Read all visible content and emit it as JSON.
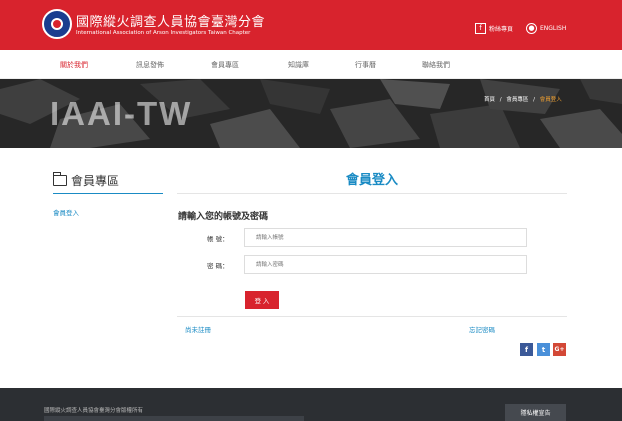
{
  "header": {
    "title": "國際縱火調查人員協會臺灣分會",
    "subtitle": "International Association of Arson Investigators Taiwan Chapter",
    "facebook_label": "粉絲專頁",
    "english_label": "ENGLISH",
    "brand_color": "#d8232d"
  },
  "nav": {
    "items": [
      {
        "label": "關於我們",
        "active": true
      },
      {
        "label": "訊息發佈",
        "active": false
      },
      {
        "label": "會員專區",
        "active": false
      },
      {
        "label": "知識庫",
        "active": false
      },
      {
        "label": "行事曆",
        "active": false
      },
      {
        "label": "聯絡我們",
        "active": false
      }
    ]
  },
  "banner": {
    "title": "IAAI-TW",
    "breadcrumb": [
      "首頁",
      "會員專區",
      "會員登入"
    ],
    "separator": "/"
  },
  "sidebar": {
    "title": "會員專區",
    "links": [
      "會員登入"
    ]
  },
  "login": {
    "heading": "會員登入",
    "prompt": "請輸入您的帳號及密碼",
    "account_label": "帳 號：",
    "account_placeholder": "請輸入帳號",
    "account_value": "",
    "password_label": "密 碼：",
    "password_placeholder": "請輸入密碼",
    "password_value": "",
    "submit_label": "登 入",
    "register_link": "尚未註冊",
    "forgot_link": "忘記密碼"
  },
  "share": {
    "icons": [
      "facebook-icon",
      "twitter-icon",
      "google-plus-icon"
    ],
    "facebook_glyph": "f",
    "twitter_glyph": "t",
    "google_glyph": "G+"
  },
  "footer": {
    "copyright": "國際縱火調查人員協會臺灣分會版權所有",
    "privacy_button": "隱私權宣告"
  },
  "icons": {
    "folder": "folder-open-icon",
    "facebook_top": "facebook-icon",
    "globe": "globe-icon"
  }
}
